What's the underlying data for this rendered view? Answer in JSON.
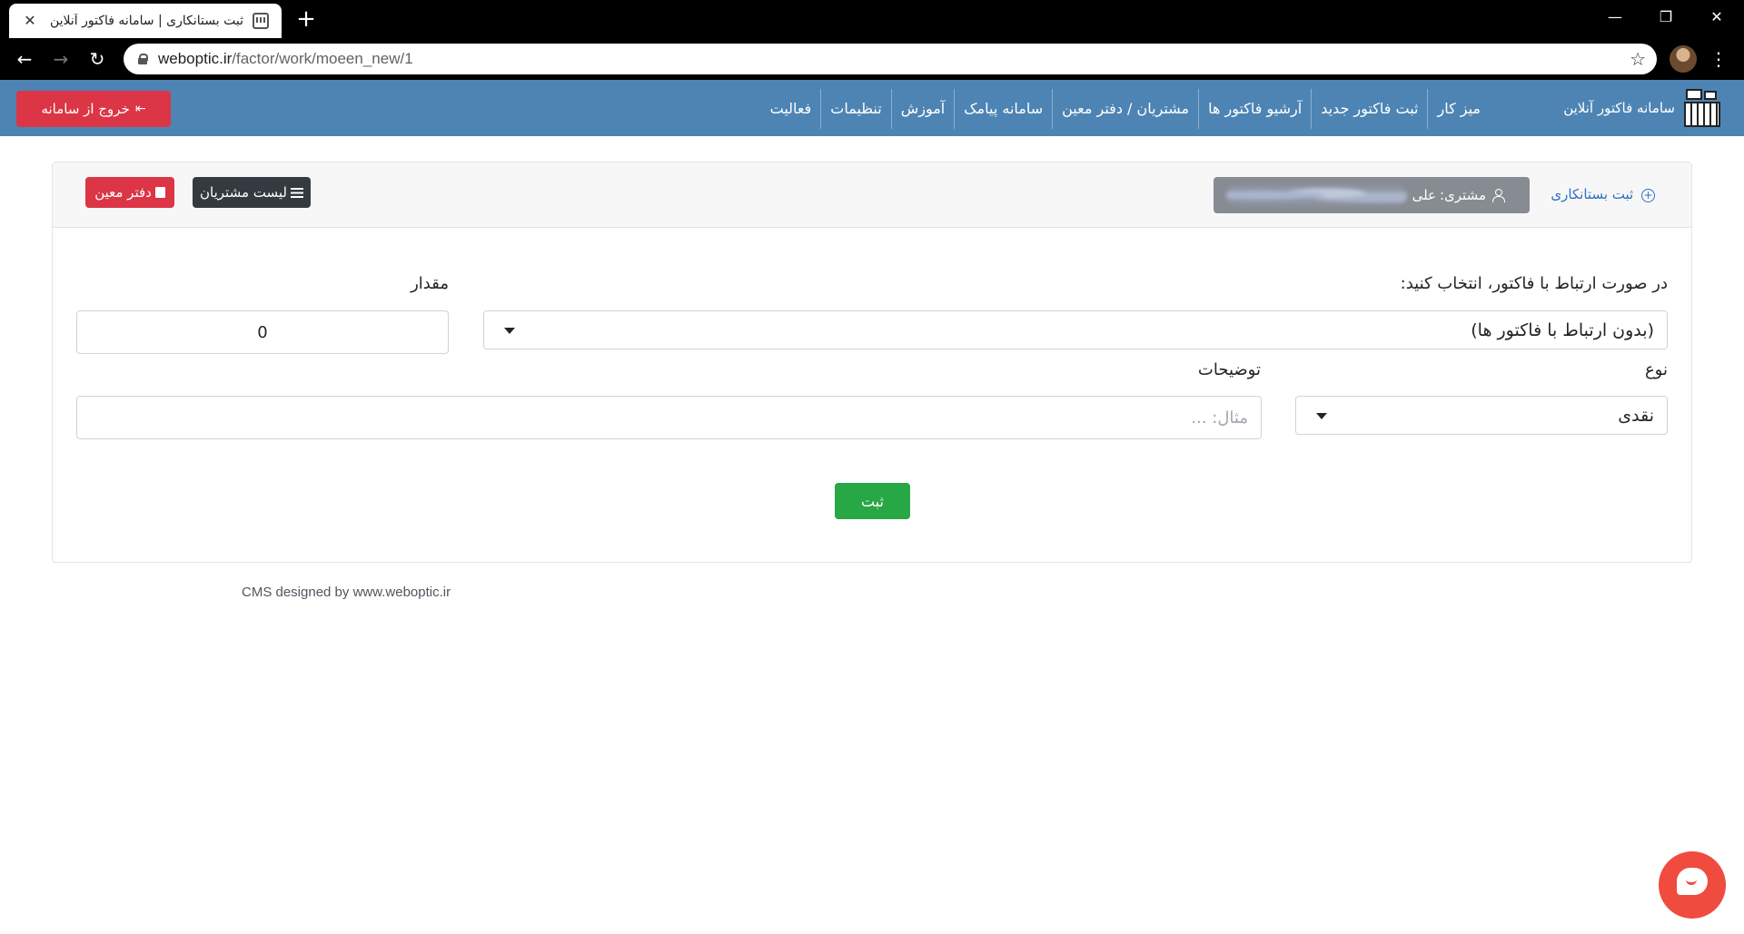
{
  "browser": {
    "tab_title": "ثبت بستانکاری | سامانه فاکتور آنلاین",
    "tab_close": "✕",
    "new_tab": "+",
    "url_host": "weboptic.ir",
    "url_path": "/factor/work/moeen_new/1",
    "back": "←",
    "forward": "→",
    "reload": "↻",
    "star": "☆",
    "menu": "⋮",
    "minimize": "—",
    "restore": "❐",
    "close": "✕"
  },
  "navbar": {
    "brand": "سامانه فاکتور آنلاین",
    "items": [
      {
        "label": "میز کار"
      },
      {
        "label": "ثبت فاکتور جدید"
      },
      {
        "label": "آرشیو فاکتور ها"
      },
      {
        "label": "مشتریان / دفتر معین"
      },
      {
        "label": "سامانه پیامک"
      },
      {
        "label": "آموزش"
      },
      {
        "label": "تنظیمات"
      },
      {
        "label": "فعالیت"
      }
    ],
    "logout_label": "خروج از سامانه",
    "logout_icon": "⇤"
  },
  "card": {
    "title": "ثبت بستانکاری",
    "plus_icon": "+",
    "customer_label": "مشتری:",
    "customer_name": "علی",
    "list_button": "لیست مشتریان",
    "ledger_button": "دفتر معین"
  },
  "form": {
    "invoice_label": "در صورت ارتباط با فاکتور، انتخاب کنید:",
    "invoice_value": "(بدون ارتباط با فاکتور ها)",
    "amount_label": "مقدار",
    "amount_value": "0",
    "type_label": "نوع",
    "type_value": "نقدی",
    "desc_label": "توضیحات",
    "desc_placeholder": "مثال: ...",
    "submit_label": "ثبت"
  },
  "footer": {
    "credit": "CMS designed by www.weboptic.ir"
  }
}
